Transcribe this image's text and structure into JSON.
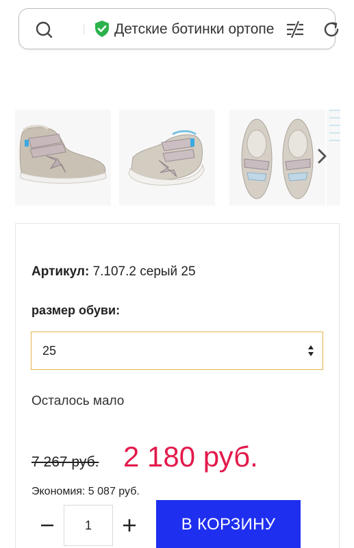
{
  "browser": {
    "search_query": "Детские ботинки ортопе",
    "icons": [
      "search-icon",
      "verified-shield-icon",
      "tune-icon",
      "reload-icon"
    ]
  },
  "gallery": {
    "images": [
      "shoe-side-view",
      "shoe-side-view-angled",
      "shoe-top-view",
      "shoe-partial"
    ],
    "next_icon": "chevron-right-icon"
  },
  "product": {
    "article_label": "Артикул:",
    "article_value": "7.107.2 серый 25",
    "size_label": "размер обуви:",
    "size_selected": "25",
    "stock_status": "Осталось мало",
    "old_price": "7 267 руб.",
    "new_price": "2 180 руб.",
    "savings": "Экономия: 5 087 руб.",
    "quantity": "1",
    "cart_button": "В КОРЗИНУ"
  },
  "colors": {
    "accent_button": "#1f2fef",
    "price_red": "#e3194b",
    "select_border": "#e3b548",
    "verified_green": "#2bb24c"
  }
}
